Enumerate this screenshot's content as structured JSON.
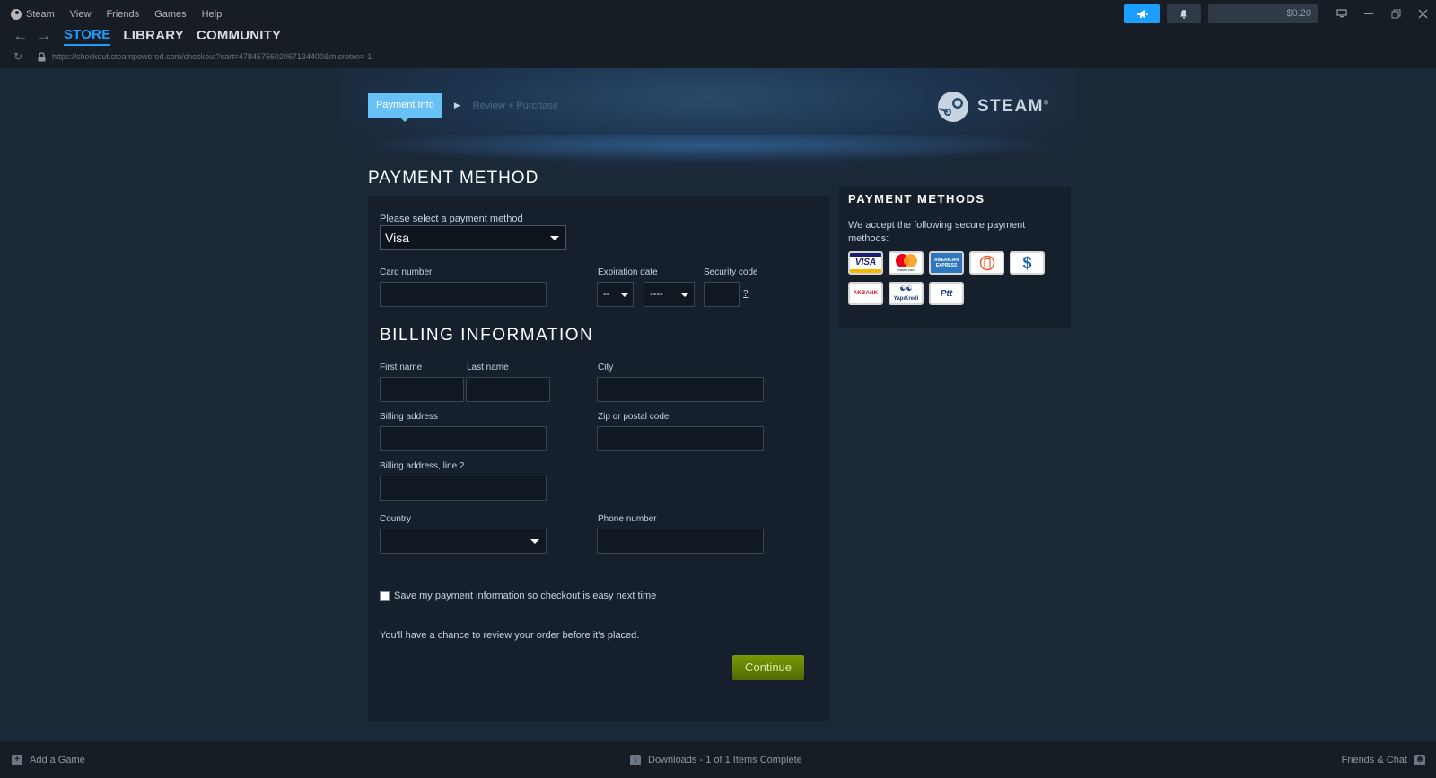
{
  "menu": {
    "items": [
      "Steam",
      "View",
      "Friends",
      "Games",
      "Help"
    ]
  },
  "wallet": {
    "balance": "$0.20"
  },
  "nav": {
    "store": "STORE",
    "library": "LIBRARY",
    "community": "COMMUNITY"
  },
  "url": "https://checkout.steampowered.com/checkout?cart=4784575602067134400&microtxn=-1",
  "steps": {
    "active": "Payment Info",
    "next": "Review + Purchase"
  },
  "brand": {
    "logo_text": "STEAM"
  },
  "payment": {
    "section_title": "PAYMENT METHOD",
    "select_label": "Please select a payment method",
    "selected_method": "Visa",
    "card_number_label": "Card number",
    "expiration_label": "Expiration date",
    "exp_month": "--",
    "exp_year": "----",
    "security_label": "Security code",
    "security_help": "?"
  },
  "billing": {
    "section_title": "BILLING INFORMATION",
    "first_name_label": "First name",
    "last_name_label": "Last name",
    "city_label": "City",
    "address_label": "Billing address",
    "zip_label": "Zip or postal code",
    "address2_label": "Billing address, line 2",
    "country_label": "Country",
    "phone_label": "Phone number"
  },
  "save_payment_label": "Save my payment information so checkout is easy next time",
  "review_note": "You'll have a chance to review your order before it's placed.",
  "continue_label": "Continue",
  "methods_panel": {
    "title": "PAYMENT METHODS",
    "description": "We accept the following secure payment methods:",
    "logos": {
      "visa": "VISA",
      "mastercard": "mastercard",
      "amex": "AMERICAN EXPRESS",
      "troy": "",
      "dollar": "$",
      "akbank": "AKBANK",
      "yapikredi": "YapıKredi",
      "ptt": "Ptt"
    }
  },
  "bottom": {
    "add_game": "Add a Game",
    "downloads": "Downloads - 1 of 1 Items Complete",
    "friends_chat": "Friends & Chat"
  },
  "colors": {
    "accent_blue": "#1a9fff",
    "step_active": "#67c1f5",
    "continue_green": "#799905",
    "background": "#1b2838"
  }
}
